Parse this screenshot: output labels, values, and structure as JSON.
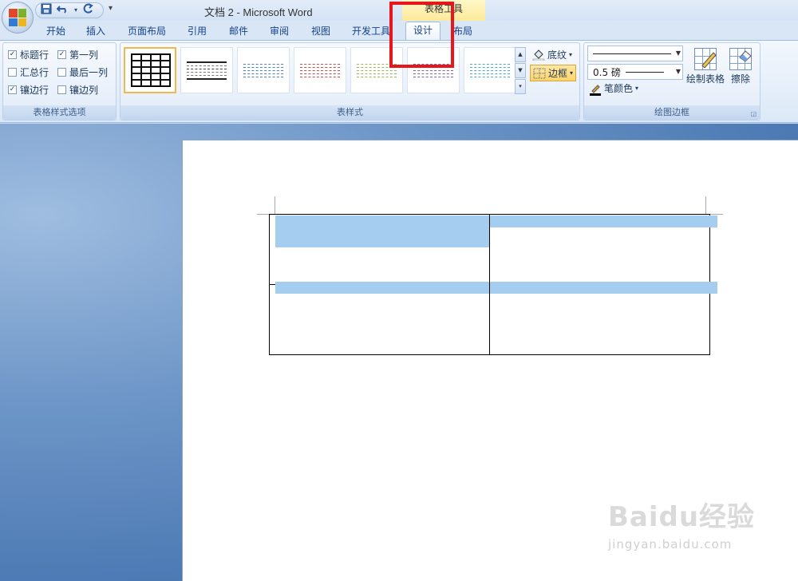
{
  "window": {
    "title": "文档 2 - Microsoft Word",
    "context_header": "表格工具"
  },
  "qat": {
    "save_icon": "save-icon",
    "undo_icon": "undo-icon",
    "redo_icon": "redo-icon",
    "customize_arrow": "▾"
  },
  "tabs": [
    {
      "label": "开始"
    },
    {
      "label": "插入"
    },
    {
      "label": "页面布局"
    },
    {
      "label": "引用"
    },
    {
      "label": "邮件"
    },
    {
      "label": "审阅"
    },
    {
      "label": "视图"
    },
    {
      "label": "开发工具"
    },
    {
      "label": "设计",
      "active": true
    },
    {
      "label": "布局"
    }
  ],
  "style_options": {
    "group_label": "表格样式选项",
    "items": [
      {
        "label": "标题行",
        "checked": true
      },
      {
        "label": "第一列",
        "checked": true
      },
      {
        "label": "汇总行",
        "checked": false
      },
      {
        "label": "最后一列",
        "checked": false
      },
      {
        "label": "镶边行",
        "checked": true
      },
      {
        "label": "镶边列",
        "checked": false
      }
    ]
  },
  "table_styles": {
    "group_label": "表样式",
    "gallery_colors": [
      "#000000",
      "#000000",
      "#4f81bd",
      "#c0504d",
      "#9bbb59",
      "#8064a2",
      "#4bacc6"
    ],
    "shading_label": "底纹",
    "borders_label": "边框"
  },
  "draw_borders": {
    "group_label": "绘图边框",
    "line_weight": "0.5 磅",
    "pen_color_label": "笔颜色",
    "draw_table_label": "绘制表格",
    "eraser_label": "擦除"
  },
  "watermark": {
    "logo": "Baidu经验",
    "url": "jingyan.baidu.com"
  },
  "colors": {
    "highlight": "#e8161b",
    "cell_shading": "#a4cdf0",
    "active_tab_bg": "#ffffff"
  }
}
